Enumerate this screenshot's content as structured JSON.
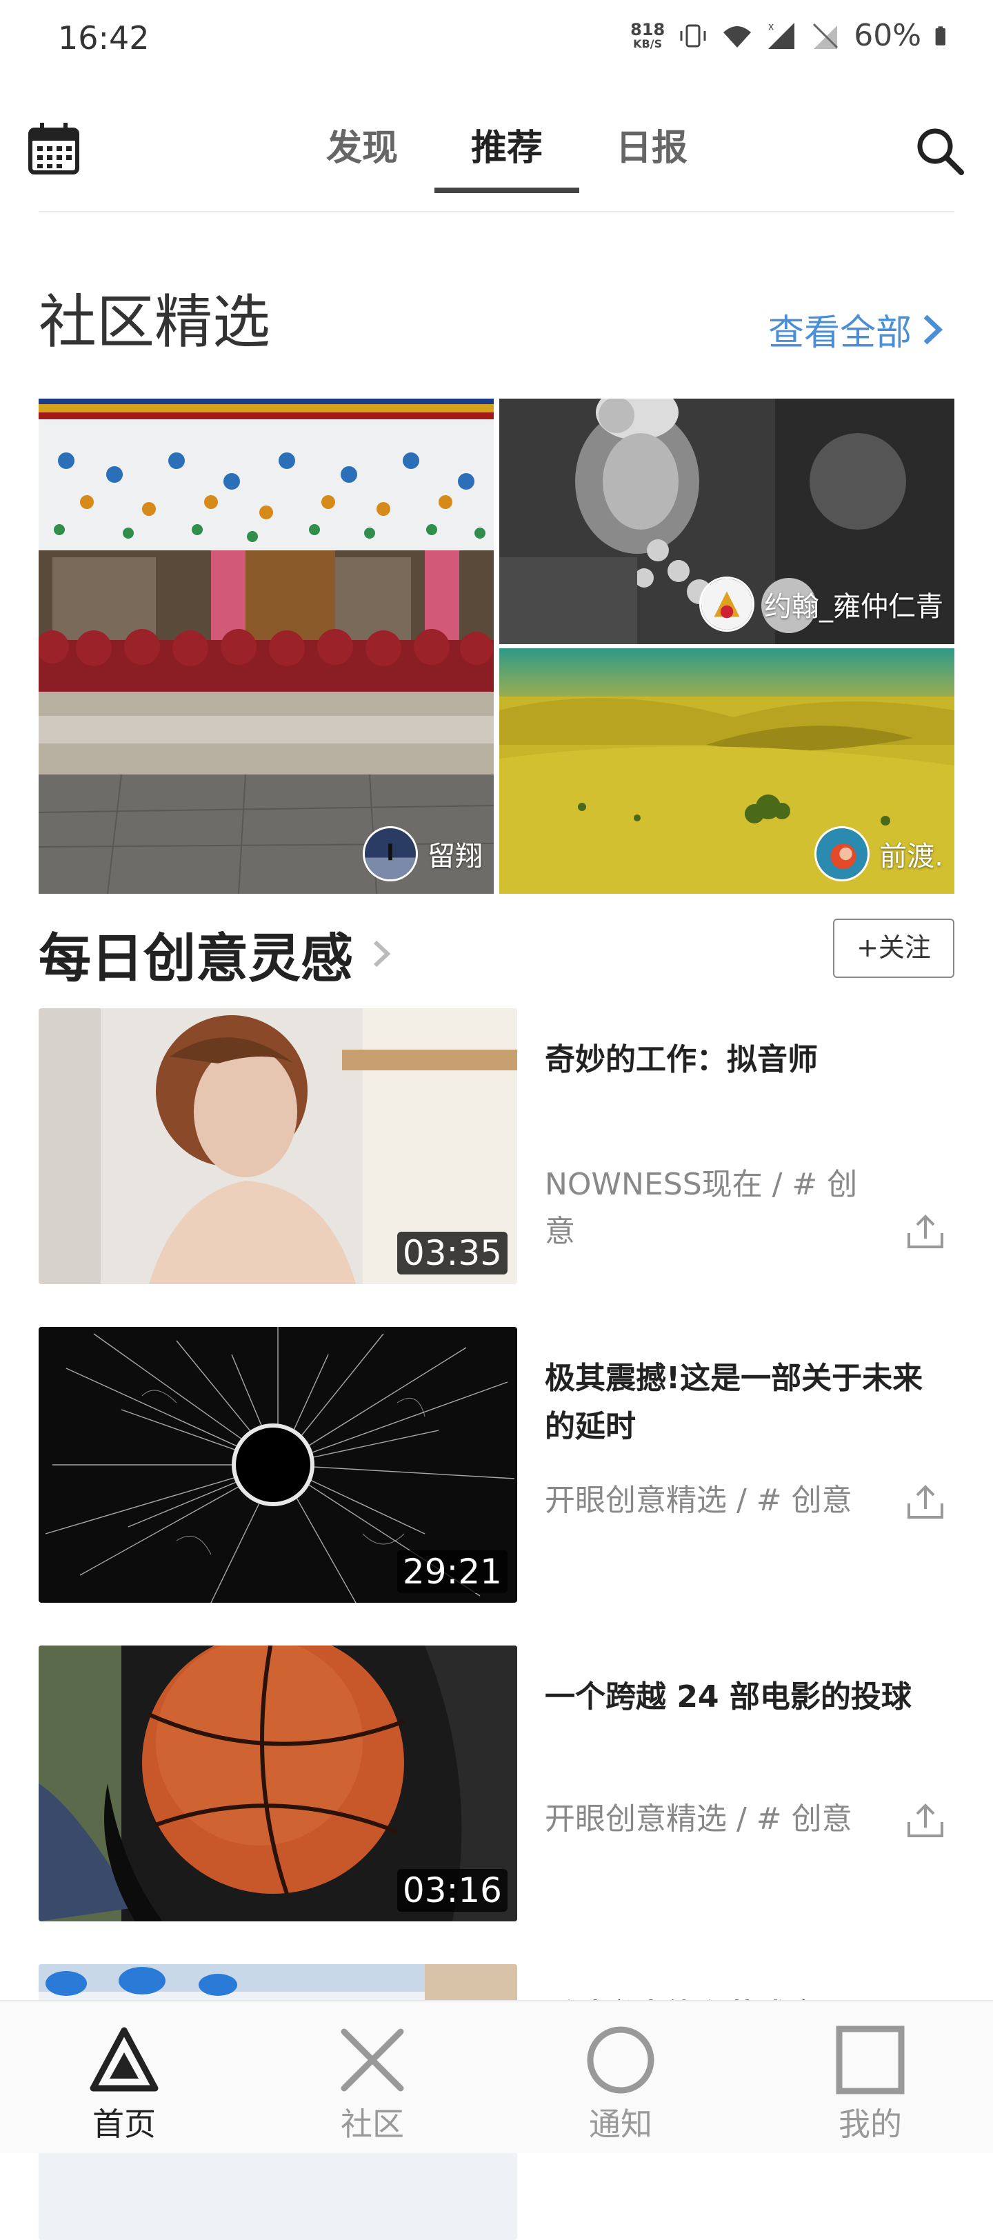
{
  "status_bar": {
    "time": "16:42",
    "net_speed": "818",
    "net_unit": "KB/S",
    "battery": "60%"
  },
  "top_nav": {
    "tabs": [
      {
        "label": "发现"
      },
      {
        "label": "推荐"
      },
      {
        "label": "日报"
      }
    ],
    "active_tab": "推荐"
  },
  "community": {
    "title": "社区精选",
    "see_all": "查看全部",
    "items": [
      {
        "author": "留翔",
        "image": "monks-temple-photo"
      },
      {
        "author": "约翰_雍仲仁青",
        "image": "portrait-bw-photo"
      },
      {
        "author": "前渡.",
        "image": "desert-dunes-photo"
      }
    ]
  },
  "daily": {
    "title": "每日创意灵感",
    "follow_label": "+关注",
    "videos": [
      {
        "title": "奇妙的工作：拟音师",
        "meta": "NOWNESS现在 / # 创意",
        "duration": "03:35"
      },
      {
        "title": "极其震撼!这是一部关于未来的延时",
        "meta": "开眼创意精选 / # 创意",
        "duration": "29:21"
      },
      {
        "title": "一个跨越 24 部电影的投球",
        "meta": "开眼创意精选 / # 创意",
        "duration": "03:16"
      },
      {
        "title": "乒球举出能主节式庄",
        "meta": "",
        "duration": ""
      }
    ]
  },
  "bottom_nav": [
    {
      "label": "首页",
      "icon": "triangle-icon"
    },
    {
      "label": "社区",
      "icon": "cross-icon"
    },
    {
      "label": "通知",
      "icon": "circle-icon"
    },
    {
      "label": "我的",
      "icon": "square-icon"
    }
  ]
}
